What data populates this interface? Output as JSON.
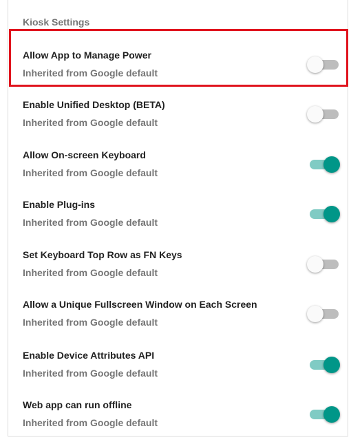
{
  "section": {
    "title": "Kiosk Settings"
  },
  "settings": [
    {
      "title": "Allow App to Manage Power",
      "subtitle": "Inherited from Google default",
      "enabled": false
    },
    {
      "title": "Enable Unified Desktop (BETA)",
      "subtitle": "Inherited from Google default",
      "enabled": false
    },
    {
      "title": "Allow On-screen Keyboard",
      "subtitle": "Inherited from Google default",
      "enabled": true
    },
    {
      "title": "Enable Plug-ins",
      "subtitle": "Inherited from Google default",
      "enabled": true
    },
    {
      "title": "Set Keyboard Top Row as FN Keys",
      "subtitle": "Inherited from Google default",
      "enabled": false
    },
    {
      "title": "Allow a Unique Fullscreen Window on Each Screen",
      "subtitle": "Inherited from Google default",
      "enabled": false
    },
    {
      "title": "Enable Device Attributes API",
      "subtitle": "Inherited from Google default",
      "enabled": true
    },
    {
      "title": "Web app can run offline",
      "subtitle": "Inherited from Google default",
      "enabled": true
    }
  ],
  "colors": {
    "toggle_on": "#009688",
    "toggle_on_track": "#80cbc4",
    "toggle_off_track": "#bdbdbd",
    "highlight": "#e0141e"
  }
}
